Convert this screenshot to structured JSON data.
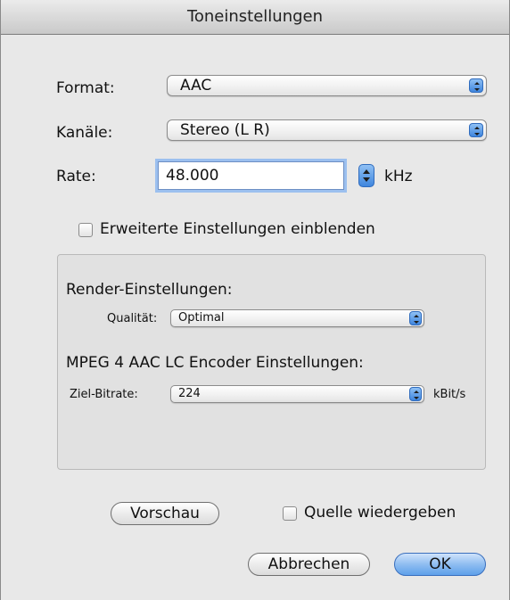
{
  "window": {
    "title": "Toneinstellungen"
  },
  "format": {
    "label": "Format:",
    "value": "AAC"
  },
  "channels": {
    "label": "Kanäle:",
    "value": "Stereo (L R)"
  },
  "rate": {
    "label": "Rate:",
    "value": "48.000",
    "unit": "kHz"
  },
  "advanced": {
    "label": "Erweiterte Einstellungen einblenden",
    "checked": false
  },
  "render": {
    "heading": "Render-Einstellungen:",
    "quality_label": "Qualität:",
    "quality_value": "Optimal"
  },
  "encoder": {
    "heading": "MPEG 4 AAC LC Encoder Einstellungen:",
    "bitrate_label": "Ziel-Bitrate:",
    "bitrate_value": "224",
    "bitrate_unit": "kBit/s"
  },
  "buttons": {
    "preview": "Vorschau",
    "play_source": "Quelle wiedergeben",
    "cancel": "Abbrechen",
    "ok": "OK"
  }
}
